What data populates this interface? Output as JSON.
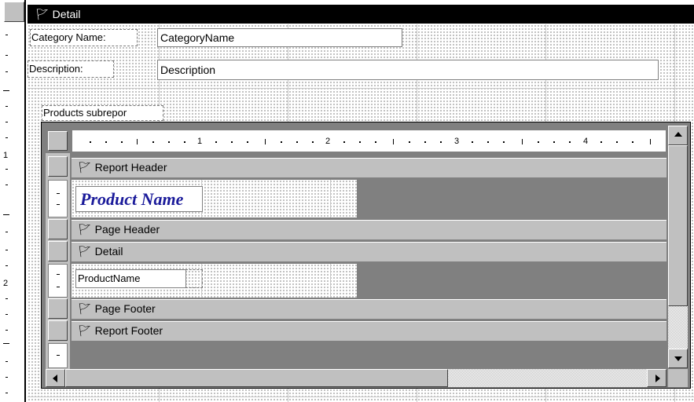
{
  "sections": {
    "detail": "Detail",
    "report_header": "Report Header",
    "page_header": "Page Header",
    "sub_detail": "Detail",
    "page_footer": "Page Footer",
    "report_footer": "Report Footer"
  },
  "section_icon": "section-marker-icon",
  "main_form": {
    "category_label": "Category Name:",
    "category_field": "CategoryName",
    "description_label": "Description:",
    "description_field": "Description",
    "subreport_label": "Products subrepor"
  },
  "subreport": {
    "header_label": "Product Name",
    "detail_field": "ProductName",
    "ruler_numbers": [
      "1",
      "2",
      "3",
      "4"
    ]
  },
  "colors": {
    "title_bar": "#000000",
    "section_bar": "#c0c0c0",
    "dark_area": "#808080",
    "header_text": "#1a1a9a"
  }
}
